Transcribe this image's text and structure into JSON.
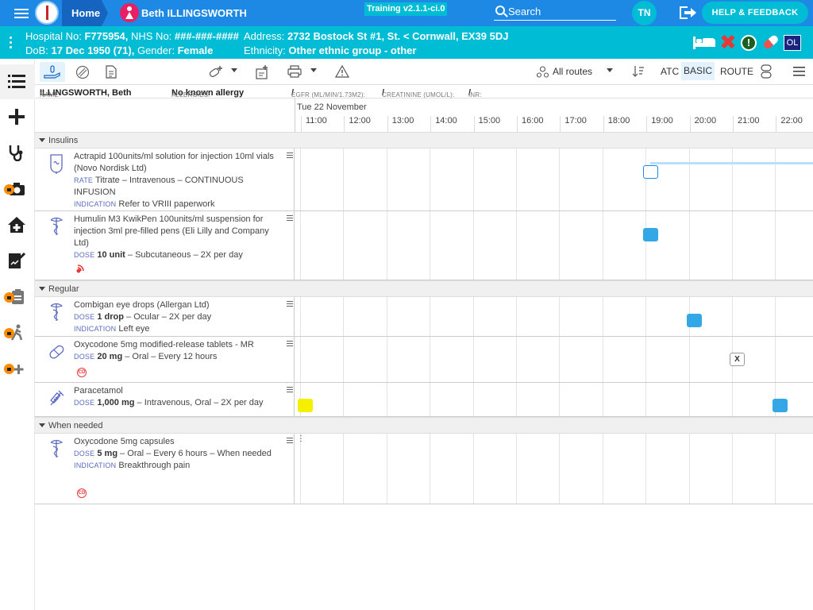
{
  "topbar": {
    "home_label": "Home",
    "patient_name": "Beth ILLINGSWORTH",
    "training_badge": "Training v2.1.1-ci.0",
    "search_placeholder": "Search",
    "user_initials": "TN",
    "help_label": "HELP & FEEDBACK",
    "brand_color": "#1e88e5"
  },
  "banner": {
    "hospital_no_label": "Hospital No:",
    "hospital_no": "F775954,",
    "nhs_no_label": "NHS No:",
    "nhs_no": "###-###-####",
    "address_label": "Address:",
    "address": "2732 Bostock St #1, St. < Cornwall, EX39 5DJ",
    "dob_label": "DoB:",
    "dob": "17 Dec 1950 (71),",
    "gender_label": "Gender:",
    "gender": "Female",
    "ethnicity_label": "Ethnicity:",
    "ethnicity": "Other ethnic group - other",
    "ol_badge": "OL",
    "alert_glyph": "!",
    "color": "#00bcd4"
  },
  "toolbar": {
    "routes_label": "All routes",
    "atc_label": "ATC",
    "basic_label": "BASIC",
    "route_label": "ROUTE"
  },
  "info_strip": {
    "name_label": "NAME",
    "name": "ILLINGSWORTH, Beth",
    "allergies_label": "ALLERGIES:",
    "allergies": "No known allergy",
    "egfr_label": "EGFR (ML/MIN/1.73M2):",
    "egfr": "/",
    "creatinine_label": "CREATININE (UMOL/L):",
    "creatinine": "/",
    "inr_label": "INR:",
    "inr": "/"
  },
  "timeline": {
    "date": "Tue 22 November",
    "hours": [
      "11:00",
      "12:00",
      "13:00",
      "14:00",
      "15:00",
      "16:00",
      "17:00",
      "18:00",
      "19:00",
      "20:00",
      "21:00",
      "22:00"
    ]
  },
  "sections": [
    {
      "title": "Insulins",
      "meds": [
        {
          "name": "Actrapid 100units/ml solution for injection 10ml vials (Novo Nordisk Ltd)",
          "line1_label": "RATE",
          "line1_bold": "",
          "line1": "Titrate – Intravenous – CONTINUOUS INFUSION",
          "line2_label": "INDICATION",
          "line2": "Refer to VRIII paperwork"
        },
        {
          "name": "Humulin M3 KwikPen 100units/ml suspension for injection 3ml pre-filled pens (Eli Lilly and Company Ltd)",
          "line1_label": "DOSE",
          "line1_bold": "10 unit",
          "line1": "– Subcutaneous – 2X per day"
        }
      ]
    },
    {
      "title": "Regular",
      "meds": [
        {
          "name": "Combigan eye drops (Allergan Ltd)",
          "line1_label": "DOSE",
          "line1_bold": "1 drop",
          "line1": "– Ocular – 2X per day",
          "line2_label": "INDICATION",
          "line2": "Left eye"
        },
        {
          "name": "Oxycodone 5mg modified-release tablets - MR",
          "line1_label": "DOSE",
          "line1_bold": "20 mg",
          "line1": "– Oral – Every 12 hours",
          "cd": "CD",
          "missed_mark": "X"
        },
        {
          "name": "Paracetamol",
          "line1_label": "DOSE",
          "line1_bold": "1,000 mg",
          "line1": "– Intravenous, Oral – 2X per day"
        }
      ]
    },
    {
      "title": "When needed",
      "meds": [
        {
          "name": "Oxycodone 5mg capsules",
          "line1_label": "DOSE",
          "line1_bold": "5 mg",
          "line1": "– Oral – Every 6 hours – When needed",
          "line2_label": "INDICATION",
          "line2": "Breakthrough pain",
          "cd": "CD"
        }
      ]
    }
  ],
  "colors": {
    "dose_planned": "#29a3e6",
    "dose_due": "#f4f000",
    "controlled_drug": "#e53935"
  }
}
